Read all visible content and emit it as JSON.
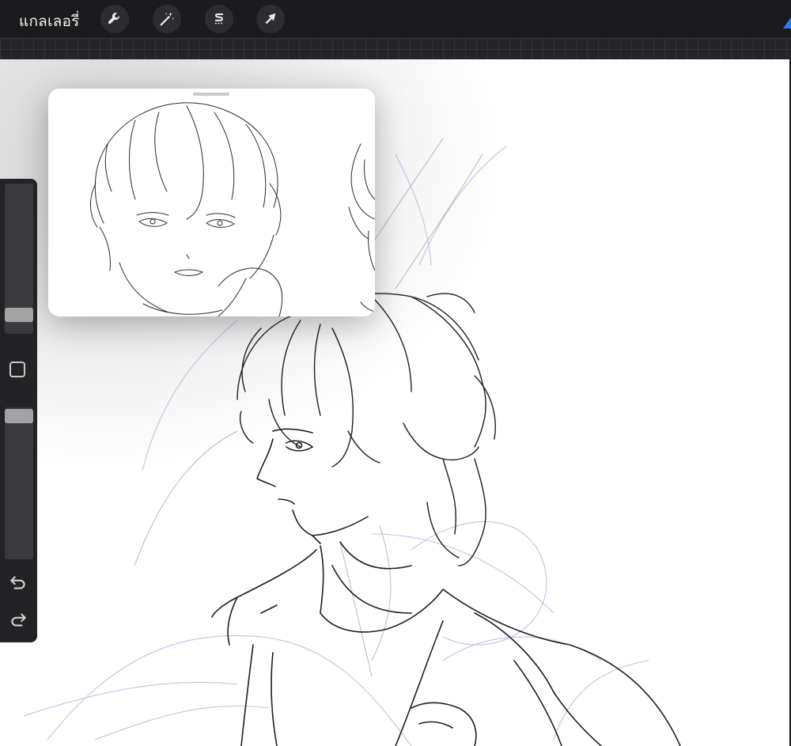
{
  "toolbar": {
    "gallery_label": "แกลเลอรี่",
    "tools": [
      {
        "name": "actions",
        "icon": "wrench-icon"
      },
      {
        "name": "adjustments",
        "icon": "magic-wand-icon"
      },
      {
        "name": "selection",
        "icon": "selection-s-icon"
      },
      {
        "name": "transform",
        "icon": "arrow-cursor-icon"
      }
    ],
    "accent_color": "#2f7bf6"
  },
  "sidebar": {
    "brush_size_level": 0.17,
    "opacity_level": 0.95,
    "modify_icon": "square-icon",
    "undo_icon": "undo-icon",
    "redo_icon": "redo-icon"
  },
  "reference_window": {
    "content": "reference-sketch"
  },
  "colors": {
    "toolbar_bg": "#1b1b1d",
    "sidebar_bg": "#232325",
    "canvas_bg": "#ffffff"
  }
}
